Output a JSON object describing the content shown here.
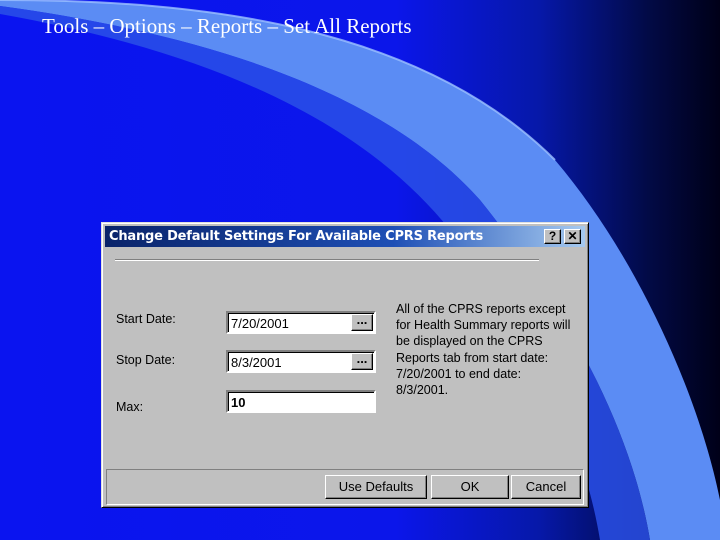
{
  "slide": {
    "title": "Tools – Options – Reports – Set All Reports"
  },
  "dialog": {
    "title": "Change Default Settings For Available CPRS Reports",
    "help_label": "?",
    "close_label": "✕",
    "fields": {
      "start_date": {
        "label": "Start Date:",
        "value": "7/20/2001",
        "button_label": "..."
      },
      "stop_date": {
        "label": "Stop Date:",
        "value": "8/3/2001",
        "button_label": "..."
      },
      "max": {
        "label": "Max:",
        "value": "10"
      }
    },
    "info_text": "All of the CPRS reports except for Health Summary reports will be displayed on the CPRS Reports tab from start date: 7/20/2001 to end date: 8/3/2001.",
    "buttons": {
      "use_defaults": "Use Defaults",
      "ok": "OK",
      "cancel": "Cancel"
    }
  },
  "colors": {
    "background_left": "#0a14f0",
    "background_right": "#000018",
    "swoosh": "#5b8cf4",
    "titlebar": "#0a246a",
    "dialog_face": "#c0c0c0"
  }
}
